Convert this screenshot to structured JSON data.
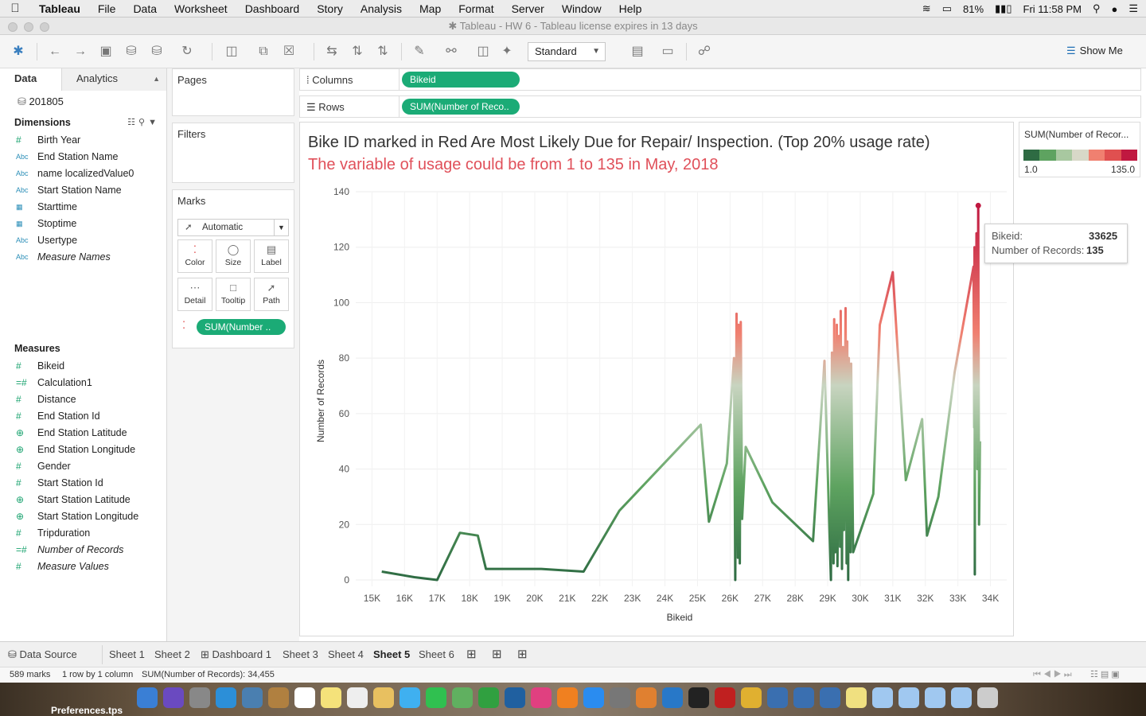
{
  "menubar": {
    "app": "Tableau",
    "items": [
      "File",
      "Data",
      "Worksheet",
      "Dashboard",
      "Story",
      "Analysis",
      "Map",
      "Format",
      "Server",
      "Window",
      "Help"
    ],
    "battery": "81%",
    "clock": "Fri 11:58 PM"
  },
  "window": {
    "title": "Tableau - HW 6 - Tableau license expires in 13 days"
  },
  "toolbar": {
    "mark_size": "Standard",
    "show_me": "Show Me"
  },
  "data_pane": {
    "tab_data": "Data",
    "tab_analytics": "Analytics",
    "datasource": "201805",
    "dimensions_label": "Dimensions",
    "dimensions": [
      {
        "type": "#",
        "name": "Birth Year",
        "italic": false
      },
      {
        "type": "Abc",
        "name": "End Station Name",
        "italic": false
      },
      {
        "type": "Abc",
        "name": "name localizedValue0",
        "italic": false
      },
      {
        "type": "Abc",
        "name": "Start Station Name",
        "italic": false
      },
      {
        "type": "date",
        "name": "Starttime",
        "italic": false
      },
      {
        "type": "date",
        "name": "Stoptime",
        "italic": false
      },
      {
        "type": "Abc",
        "name": "Usertype",
        "italic": false
      },
      {
        "type": "Abc",
        "name": "Measure Names",
        "italic": true
      }
    ],
    "measures_label": "Measures",
    "measures": [
      {
        "type": "#",
        "name": "Bikeid",
        "italic": false
      },
      {
        "type": "calc",
        "name": "Calculation1",
        "italic": false
      },
      {
        "type": "#",
        "name": "Distance",
        "italic": false
      },
      {
        "type": "#",
        "name": "End Station Id",
        "italic": false
      },
      {
        "type": "geo",
        "name": "End Station Latitude",
        "italic": false
      },
      {
        "type": "geo",
        "name": "End Station Longitude",
        "italic": false
      },
      {
        "type": "#",
        "name": "Gender",
        "italic": false
      },
      {
        "type": "#",
        "name": "Start Station Id",
        "italic": false
      },
      {
        "type": "geo",
        "name": "Start Station Latitude",
        "italic": false
      },
      {
        "type": "geo",
        "name": "Start Station Longitude",
        "italic": false
      },
      {
        "type": "#",
        "name": "Tripduration",
        "italic": false
      },
      {
        "type": "calc",
        "name": "Number of Records",
        "italic": true
      },
      {
        "type": "#",
        "name": "Measure Values",
        "italic": true
      }
    ]
  },
  "shelves": {
    "pages": "Pages",
    "filters": "Filters",
    "marks": "Marks",
    "mark_type": "Automatic",
    "mark_buttons": [
      "Color",
      "Size",
      "Label",
      "Detail",
      "Tooltip",
      "Path"
    ],
    "color_pill": "SUM(Number ..",
    "columns_label": "Columns",
    "columns_pill": "Bikeid",
    "rows_label": "Rows",
    "rows_pill": "SUM(Number of Reco.."
  },
  "viz": {
    "title": "Bike ID marked in Red Are Most Likely Due for Repair/ Inspection. (Top 20% usage rate)",
    "subtitle": "The variable of usage could be from 1 to 135 in May, 2018"
  },
  "legend": {
    "title": "SUM(Number of Recor...",
    "min": "1.0",
    "max": "135.0",
    "colors": [
      "#2e6b43",
      "#5ea360",
      "#a8c8a0",
      "#d8d8c8",
      "#f08070",
      "#e05050",
      "#c01840"
    ]
  },
  "tooltip": {
    "k1": "Bikeid:",
    "v1": "33625",
    "k2": "Number of Records:",
    "v2": "135"
  },
  "chart_data": {
    "type": "line",
    "xlabel": "Bikeid",
    "ylabel": "Number of Records",
    "xlim": [
      14500,
      34500
    ],
    "ylim": [
      0,
      140
    ],
    "xticks": [
      "15K",
      "16K",
      "17K",
      "18K",
      "19K",
      "20K",
      "21K",
      "22K",
      "23K",
      "24K",
      "25K",
      "26K",
      "27K",
      "28K",
      "29K",
      "30K",
      "31K",
      "32K",
      "33K",
      "34K"
    ],
    "yticks": [
      "0",
      "20",
      "40",
      "60",
      "80",
      "100",
      "120",
      "140"
    ],
    "color_scale": {
      "min": 1,
      "max": 135,
      "low": "#2e6b43",
      "mid": "#d4d8c8",
      "high": "#c01840"
    },
    "x": [
      15300,
      16300,
      17000,
      17700,
      18250,
      18500,
      19500,
      20200,
      21500,
      22600,
      25100,
      25350,
      25900,
      26120,
      26160,
      26200,
      26240,
      26260,
      26300,
      26330,
      26370,
      26480,
      27300,
      28550,
      28900,
      29100,
      29130,
      29180,
      29200,
      29230,
      29280,
      29300,
      29350,
      29380,
      29400,
      29440,
      29470,
      29500,
      29550,
      29580,
      29600,
      29630,
      29650,
      29700,
      29720,
      29780,
      30400,
      30600,
      31000,
      31400,
      31900,
      32050,
      32400,
      32900,
      33480,
      33500,
      33510,
      33520,
      33530,
      33550,
      33570,
      33600,
      33625,
      33650,
      33680
    ],
    "y": [
      3,
      1,
      0,
      17,
      16,
      4,
      4,
      4,
      3,
      25,
      56,
      21,
      42,
      80,
      0,
      96,
      8,
      92,
      6,
      93,
      22,
      48,
      28,
      14,
      79,
      0,
      82,
      6,
      94,
      10,
      92,
      5,
      88,
      12,
      97,
      4,
      84,
      18,
      98,
      6,
      86,
      0,
      80,
      10,
      78,
      10,
      31,
      92,
      111,
      36,
      58,
      16,
      30,
      75,
      113,
      55,
      120,
      2,
      118,
      60,
      125,
      40,
      135,
      20,
      50
    ]
  },
  "sheets": {
    "datasource_tab": "Data Source",
    "tabs": [
      "Sheet 1",
      "Sheet 2",
      "Dashboard 1",
      "Sheet 3",
      "Sheet 4",
      "Sheet 5",
      "Sheet 6"
    ],
    "active": "Sheet 5"
  },
  "status": {
    "marks": "589 marks",
    "dims": "1 row by 1 column",
    "sum": "SUM(Number of Records): 34,455"
  },
  "dock": {
    "label": "Preferences.tps"
  }
}
